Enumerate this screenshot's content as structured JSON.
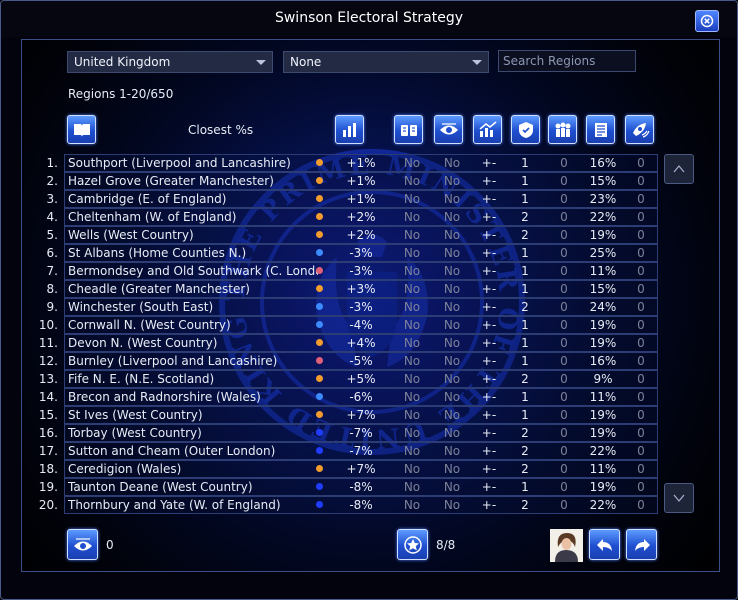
{
  "window": {
    "title": "Swinson Electoral Strategy"
  },
  "filters": {
    "region_select": "United Kingdom",
    "secondary_select": "None",
    "search_placeholder": "Search Regions"
  },
  "regions_label": "Regions 1-20/650",
  "sort_label": "Closest %s",
  "rows": [
    {
      "rank": "1.",
      "name": "Southport (Liverpool and Lancashire)",
      "dot": "#f39c2e",
      "pct": "+1%",
      "c3": "No",
      "c4": "No",
      "c5": "+-",
      "c6": "1",
      "c7": "0",
      "c8": "16%",
      "c9": "0"
    },
    {
      "rank": "2.",
      "name": "Hazel Grove (Greater Manchester)",
      "dot": "#f39c2e",
      "pct": "+1%",
      "c3": "No",
      "c4": "No",
      "c5": "+-",
      "c6": "1",
      "c7": "0",
      "c8": "15%",
      "c9": "0"
    },
    {
      "rank": "3.",
      "name": "Cambridge (E. of England)",
      "dot": "#f39c2e",
      "pct": "+1%",
      "c3": "No",
      "c4": "No",
      "c5": "+-",
      "c6": "1",
      "c7": "0",
      "c8": "23%",
      "c9": "0"
    },
    {
      "rank": "4.",
      "name": "Cheltenham (W. of England)",
      "dot": "#f39c2e",
      "pct": "+2%",
      "c3": "No",
      "c4": "No",
      "c5": "+-",
      "c6": "2",
      "c7": "0",
      "c8": "22%",
      "c9": "0"
    },
    {
      "rank": "5.",
      "name": "Wells (West Country)",
      "dot": "#f39c2e",
      "pct": "+2%",
      "c3": "No",
      "c4": "No",
      "c5": "+-",
      "c6": "2",
      "c7": "0",
      "c8": "19%",
      "c9": "0"
    },
    {
      "rank": "6.",
      "name": "St Albans (Home Counties N.)",
      "dot": "#3d8cff",
      "pct": "-3%",
      "c3": "No",
      "c4": "No",
      "c5": "+-",
      "c6": "1",
      "c7": "0",
      "c8": "25%",
      "c9": "0"
    },
    {
      "rank": "7.",
      "name": "Bermondsey and Old Southwark (C. London)",
      "dot": "#e0607a",
      "pct": "-3%",
      "c3": "No",
      "c4": "No",
      "c5": "+-",
      "c6": "1",
      "c7": "0",
      "c8": "11%",
      "c9": "0"
    },
    {
      "rank": "8.",
      "name": "Cheadle (Greater Manchester)",
      "dot": "#f39c2e",
      "pct": "+3%",
      "c3": "No",
      "c4": "No",
      "c5": "+-",
      "c6": "1",
      "c7": "0",
      "c8": "15%",
      "c9": "0"
    },
    {
      "rank": "9.",
      "name": "Winchester (South East)",
      "dot": "#3d8cff",
      "pct": "-3%",
      "c3": "No",
      "c4": "No",
      "c5": "+-",
      "c6": "2",
      "c7": "0",
      "c8": "24%",
      "c9": "0"
    },
    {
      "rank": "10.",
      "name": "Cornwall N. (West Country)",
      "dot": "#3d8cff",
      "pct": "-4%",
      "c3": "No",
      "c4": "No",
      "c5": "+-",
      "c6": "1",
      "c7": "0",
      "c8": "19%",
      "c9": "0"
    },
    {
      "rank": "11.",
      "name": "Devon N. (West Country)",
      "dot": "#f39c2e",
      "pct": "+4%",
      "c3": "No",
      "c4": "No",
      "c5": "+-",
      "c6": "1",
      "c7": "0",
      "c8": "19%",
      "c9": "0"
    },
    {
      "rank": "12.",
      "name": "Burnley (Liverpool and Lancashire)",
      "dot": "#e0607a",
      "pct": "-5%",
      "c3": "No",
      "c4": "No",
      "c5": "+-",
      "c6": "1",
      "c7": "0",
      "c8": "16%",
      "c9": "0"
    },
    {
      "rank": "13.",
      "name": "Fife N. E. (N.E. Scotland)",
      "dot": "#f39c2e",
      "pct": "+5%",
      "c3": "No",
      "c4": "No",
      "c5": "+-",
      "c6": "2",
      "c7": "0",
      "c8": "9%",
      "c9": "0"
    },
    {
      "rank": "14.",
      "name": "Brecon and Radnorshire (Wales)",
      "dot": "#3d8cff",
      "pct": "-6%",
      "c3": "No",
      "c4": "No",
      "c5": "+-",
      "c6": "1",
      "c7": "0",
      "c8": "11%",
      "c9": "0"
    },
    {
      "rank": "15.",
      "name": "St Ives (West Country)",
      "dot": "#f39c2e",
      "pct": "+7%",
      "c3": "No",
      "c4": "No",
      "c5": "+-",
      "c6": "1",
      "c7": "0",
      "c8": "19%",
      "c9": "0"
    },
    {
      "rank": "16.",
      "name": "Torbay (West Country)",
      "dot": "#1f3cff",
      "pct": "-7%",
      "c3": "No",
      "c4": "No",
      "c5": "+-",
      "c6": "2",
      "c7": "0",
      "c8": "19%",
      "c9": "0"
    },
    {
      "rank": "17.",
      "name": "Sutton and Cheam (Outer London)",
      "dot": "#1f3cff",
      "pct": "-7%",
      "c3": "No",
      "c4": "No",
      "c5": "+-",
      "c6": "2",
      "c7": "0",
      "c8": "22%",
      "c9": "0"
    },
    {
      "rank": "18.",
      "name": "Ceredigion (Wales)",
      "dot": "#f39c2e",
      "pct": "+7%",
      "c3": "No",
      "c4": "No",
      "c5": "+-",
      "c6": "2",
      "c7": "0",
      "c8": "11%",
      "c9": "0"
    },
    {
      "rank": "19.",
      "name": "Taunton Deane (West Country)",
      "dot": "#1f3cff",
      "pct": "-8%",
      "c3": "No",
      "c4": "No",
      "c5": "+-",
      "c6": "1",
      "c7": "0",
      "c8": "19%",
      "c9": "0"
    },
    {
      "rank": "20.",
      "name": "Thornbury and Yate (W. of England)",
      "dot": "#1f3cff",
      "pct": "-8%",
      "c3": "No",
      "c4": "No",
      "c5": "+-",
      "c6": "2",
      "c7": "0",
      "c8": "22%",
      "c9": "0"
    }
  ],
  "footer": {
    "watch_count": "0",
    "page_indicator": "8/8"
  },
  "seal_text": "THE PRIME MINISTER OF THE UNITED KINGDOM · SEAL OF THE",
  "icons": {
    "close": "close-icon",
    "book": "book-icon",
    "chart": "bar-chart-icon",
    "columns": [
      "cards-icon",
      "eye-icon",
      "trend-chart-icon",
      "shield-icon",
      "people-icon",
      "document-icon",
      "satellite-icon"
    ],
    "watch": "eye-icon",
    "star": "star-icon",
    "back": "back-arrow-icon",
    "forward": "forward-arrow-icon"
  }
}
